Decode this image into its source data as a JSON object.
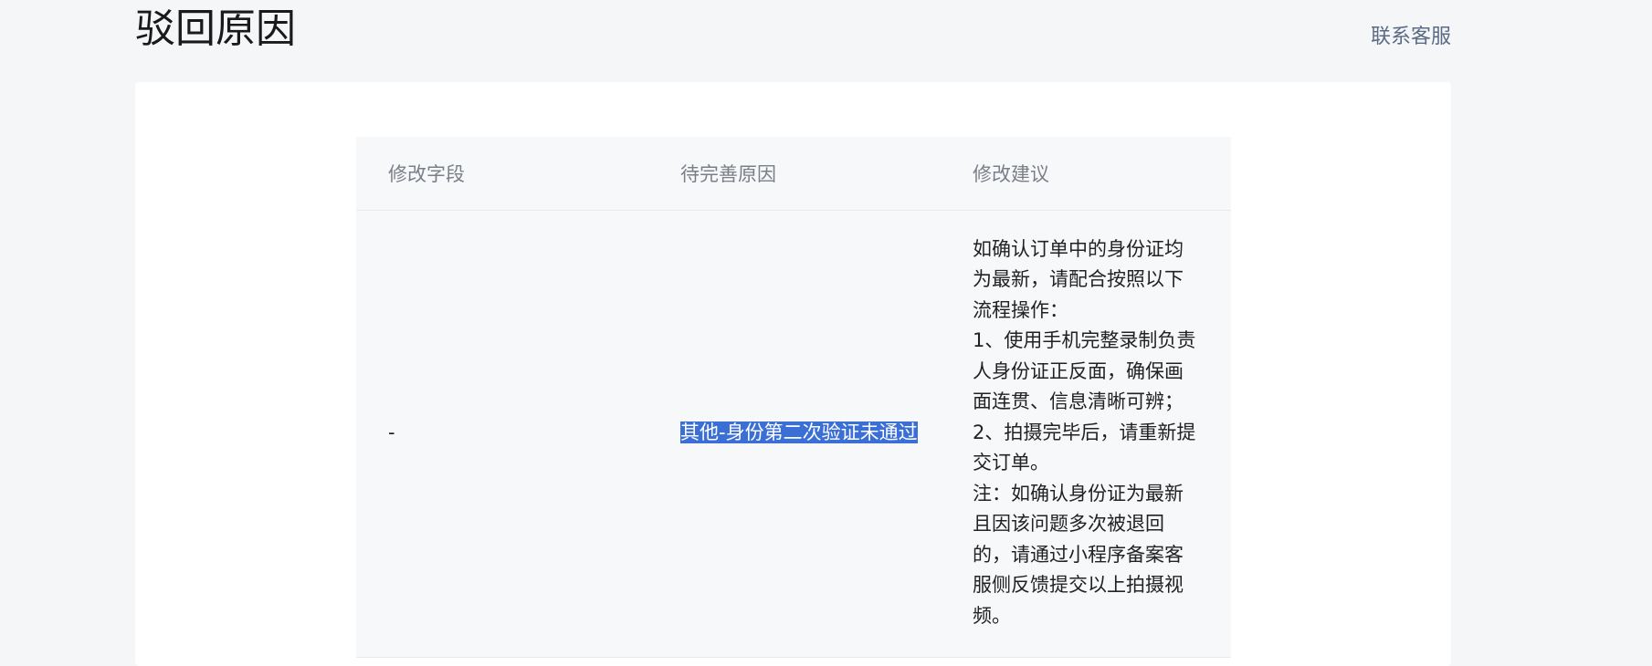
{
  "header": {
    "title": "驳回原因",
    "contact_label": "联系客服"
  },
  "table": {
    "columns": [
      "修改字段",
      "待完善原因",
      "修改建议"
    ],
    "rows": [
      {
        "field": "-",
        "reason": "其他-身份第二次验证未通过",
        "reason_selected": true,
        "suggestion_lines": [
          "如确认订单中的身份证均",
          "为最新，请配合按照以下",
          "流程操作：",
          "1、使用手机完整录制负责",
          "人身份证正反面，确保画",
          "面连贯、信息清晰可辨；",
          "2、拍摄完毕后，请重新提",
          "交订单。",
          "注：如确认身份证为最新",
          "且因该问题多次被退回",
          "的，请通过小程序备案客",
          "服侧反馈提交以上拍摄视",
          "频。"
        ]
      }
    ]
  },
  "colors": {
    "background": "#f5f6f8",
    "card": "#ffffff",
    "table_bg": "#f7f8fa",
    "selection": "#3b6fd6",
    "link": "#5b6b86"
  }
}
